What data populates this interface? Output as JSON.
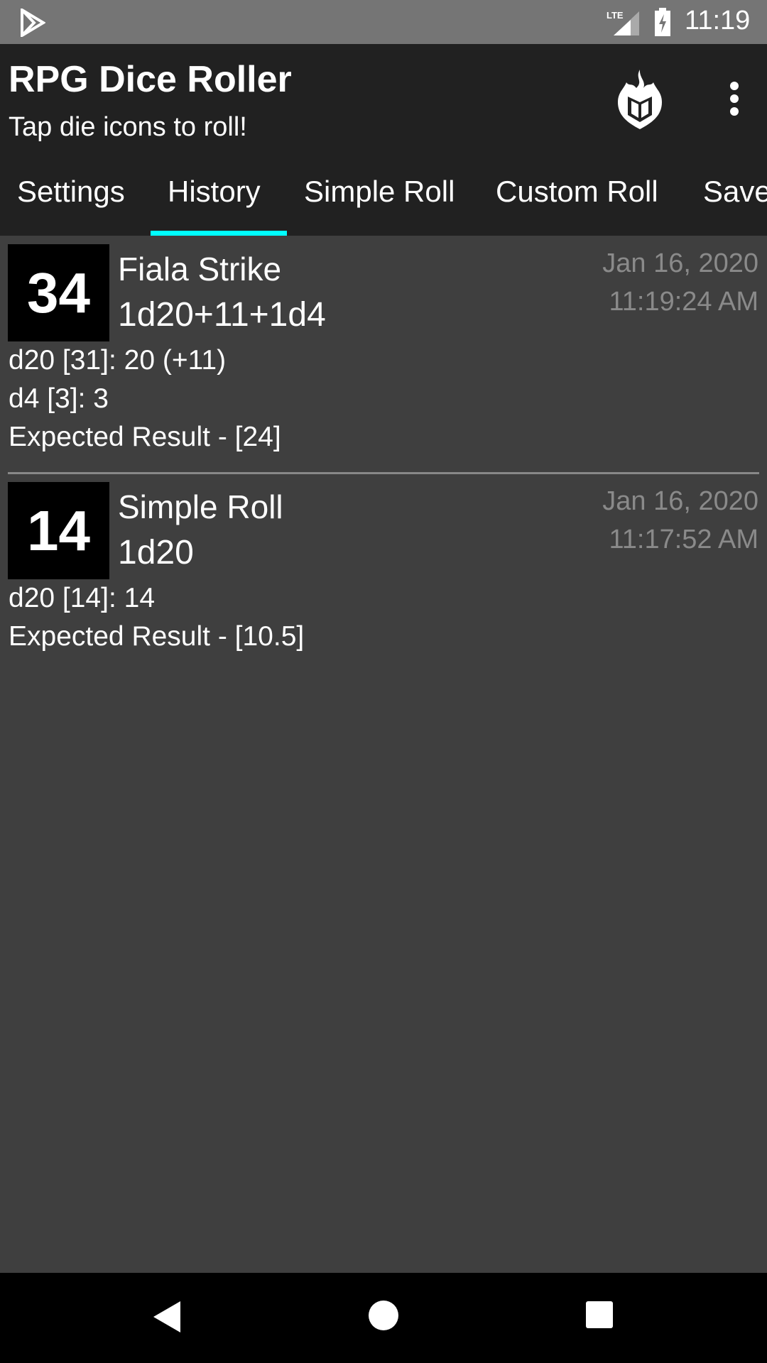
{
  "status_bar": {
    "time": "11:19",
    "network": "LTE"
  },
  "app_bar": {
    "title": "RPG Dice Roller",
    "subtitle": "Tap die icons to roll!"
  },
  "tabs": [
    {
      "label": "Settings"
    },
    {
      "label": "History",
      "selected": true
    },
    {
      "label": "Simple Roll"
    },
    {
      "label": "Custom Roll"
    },
    {
      "label": "Save"
    }
  ],
  "history": [
    {
      "result": "34",
      "name": "Fiala Strike",
      "formula": "1d20+11+1d4",
      "date": "Jan 16, 2020",
      "time": "11:19:24 AM",
      "lines": [
        "d20 [31]: 20 (+11)",
        "d4 [3]: 3",
        "Expected Result - [24]"
      ]
    },
    {
      "result": "14",
      "name": "Simple Roll",
      "formula": "1d20",
      "date": "Jan 16, 2020",
      "time": "11:17:52 AM",
      "lines": [
        "d20 [14]: 14",
        "Expected Result - [10.5]"
      ]
    }
  ],
  "colors": {
    "accent": "#00ffff",
    "app_bar": "#212121",
    "background": "#3f3f3f"
  }
}
